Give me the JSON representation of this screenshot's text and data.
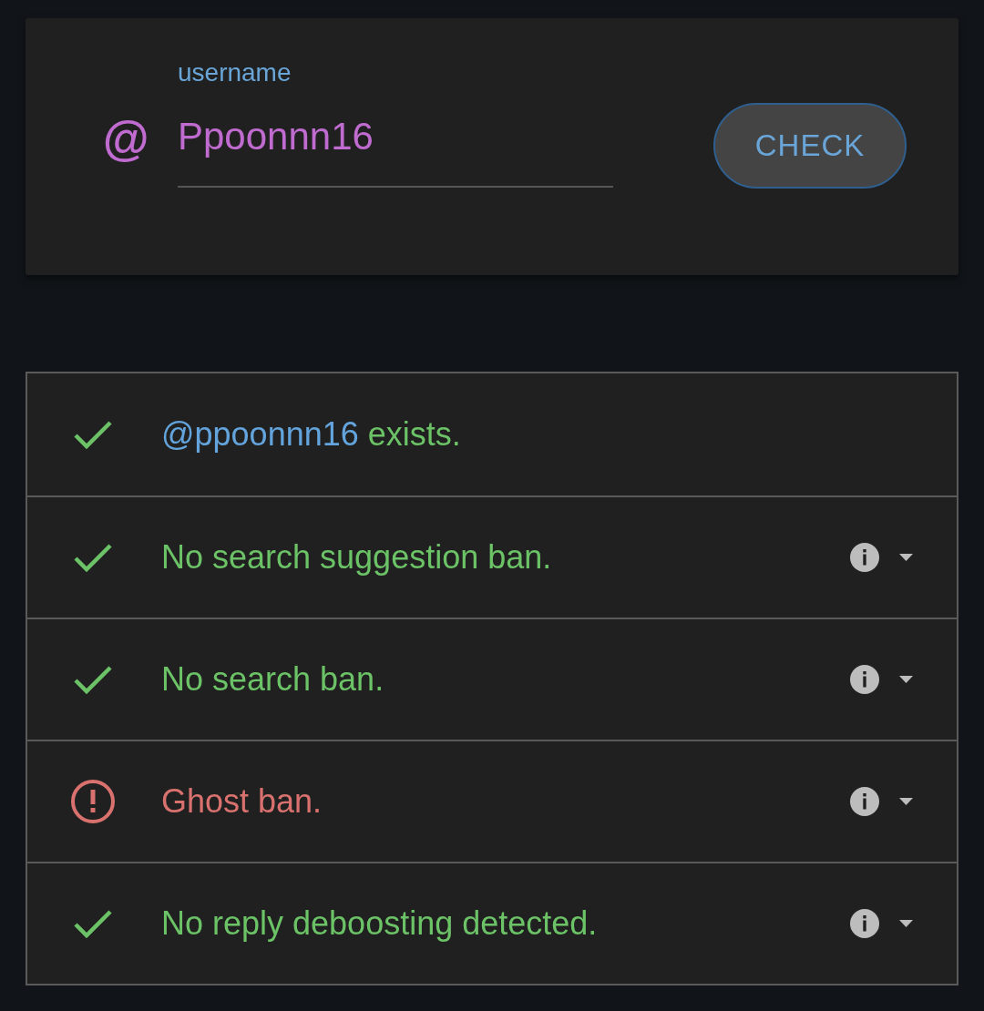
{
  "search_card": {
    "prefix": "@",
    "field": {
      "label": "username",
      "value": "Ppoonnn16"
    },
    "button": {
      "label": "CHECK"
    }
  },
  "results": [
    {
      "kind": "pass",
      "handle": "@ppoonnn16",
      "text": "exists.",
      "details": false
    },
    {
      "kind": "pass",
      "text": "No search suggestion ban.",
      "details": true
    },
    {
      "kind": "pass",
      "text": "No search ban.",
      "details": true
    },
    {
      "kind": "fail",
      "text": "Ghost ban.",
      "details": true
    },
    {
      "kind": "pass",
      "text": "No reply deboosting detected.",
      "details": true
    }
  ]
}
